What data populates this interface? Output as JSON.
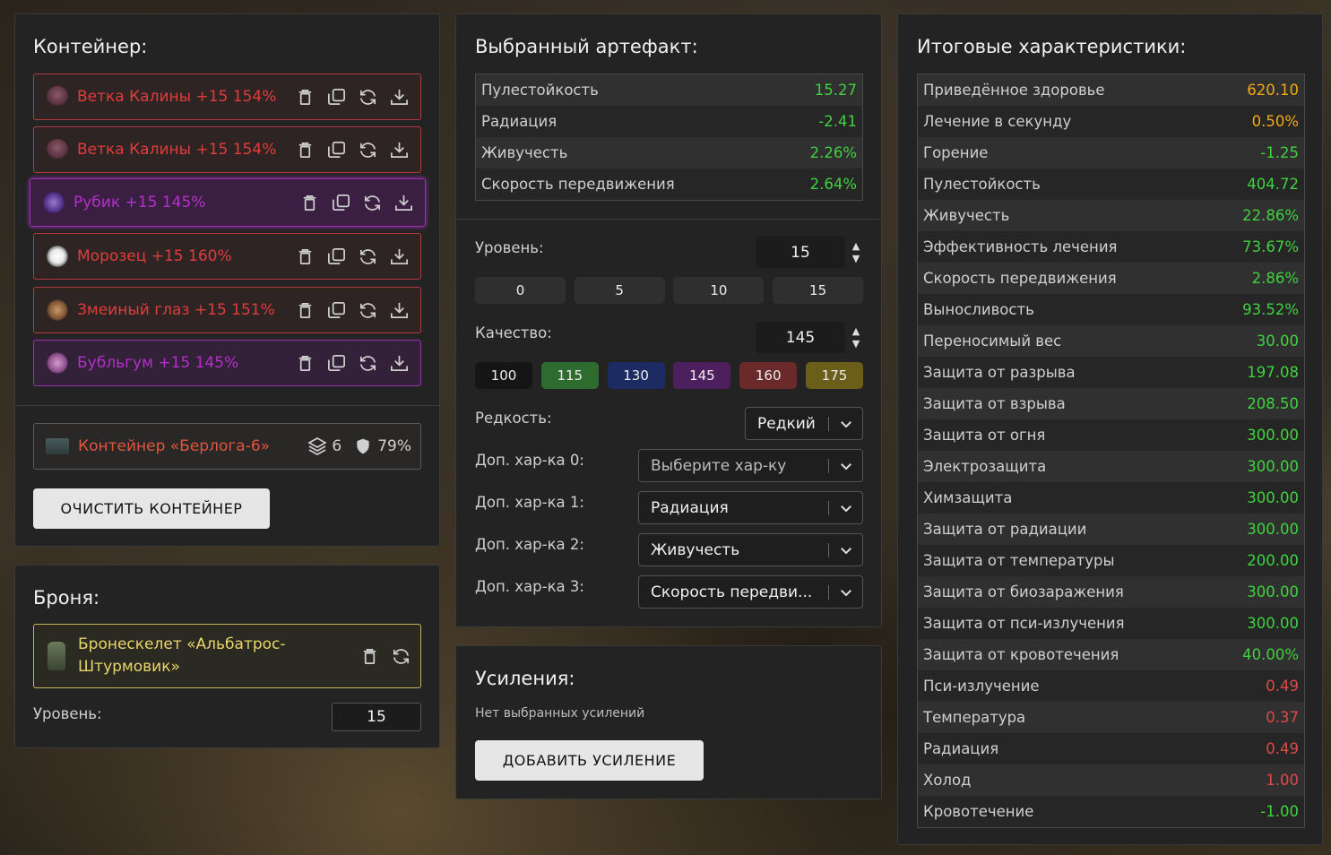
{
  "container": {
    "title": "Контейнер:",
    "artifacts": [
      {
        "name": "Ветка Калины",
        "suffix": " +15 154%",
        "color": "#e03c3c",
        "icon": "branch-icon"
      },
      {
        "name": "Ветка Калины",
        "suffix": " +15 154%",
        "color": "#e03c3c",
        "icon": "branch-icon"
      },
      {
        "name": "Рубик",
        "suffix": " +15 145%",
        "color": "#b530c9",
        "icon": "cube-icon"
      },
      {
        "name": "Морозец",
        "suffix": " +15 160%",
        "color": "#e03c3c",
        "icon": "frost-orb-icon"
      },
      {
        "name": "Змеиный глаз",
        "suffix": " +15 151%",
        "color": "#e03c3c",
        "icon": "snake-eye-icon"
      },
      {
        "name": "Бубльгум",
        "suffix": " +15 145%",
        "color": "#b530c9",
        "icon": "bubblegum-icon"
      }
    ],
    "item": {
      "name": "Контейнер «Берлога-6»",
      "slots": "6",
      "protection": "79%",
      "color": "#e0553c"
    },
    "clear_label": "ОЧИСТИТЬ КОНТЕЙНЕР"
  },
  "armor": {
    "title": "Броня:",
    "item_name": "Бронескелет «Альбатрос-Штурмовик»",
    "color": "#e9d56a",
    "level_label": "Уровень:",
    "level_value": "15"
  },
  "artifact": {
    "title": "Выбранный артефакт:",
    "stats": [
      {
        "label": "Пулестойкость",
        "value": "15.27",
        "tone": "green"
      },
      {
        "label": "Радиация",
        "value": "-2.41",
        "tone": "green"
      },
      {
        "label": "Живучесть",
        "value": "2.26%",
        "tone": "green"
      },
      {
        "label": "Скорость передвижения",
        "value": "2.64%",
        "tone": "green"
      }
    ],
    "level_label": "Уровень:",
    "level_value": "15",
    "level_presets": [
      "0",
      "5",
      "10",
      "15"
    ],
    "quality_label": "Качество:",
    "quality_value": "145",
    "quality_presets": [
      {
        "label": "100",
        "color": "#151515"
      },
      {
        "label": "115",
        "color": "#2e6b2e"
      },
      {
        "label": "130",
        "color": "#1c2c63"
      },
      {
        "label": "145",
        "color": "#4e1f5e"
      },
      {
        "label": "160",
        "color": "#6b2a2a"
      },
      {
        "label": "175",
        "color": "#6b5e1a"
      }
    ],
    "rarity_label": "Редкость:",
    "rarity_value": "Редкий",
    "extra": [
      {
        "label": "Доп. хар-ка 0:",
        "value": "Выберите хар-ку",
        "placeholder": true
      },
      {
        "label": "Доп. хар-ка 1:",
        "value": "Радиация",
        "placeholder": false
      },
      {
        "label": "Доп. хар-ка 2:",
        "value": "Живучесть",
        "placeholder": false
      },
      {
        "label": "Доп. хар-ка 3:",
        "value": "Скорость передви...",
        "placeholder": false
      }
    ]
  },
  "boosts": {
    "title": "Усиления:",
    "empty_text": "Нет выбранных усилений",
    "add_label": "ДОБАВИТЬ УСИЛЕНИЕ"
  },
  "totals": {
    "title": "Итоговые характеристики:",
    "stats": [
      {
        "label": "Приведённое здоровье",
        "value": "620.10",
        "tone": "orange"
      },
      {
        "label": "Лечение в секунду",
        "value": "0.50%",
        "tone": "orange"
      },
      {
        "label": "Горение",
        "value": "-1.25",
        "tone": "green"
      },
      {
        "label": "Пулестойкость",
        "value": "404.72",
        "tone": "green"
      },
      {
        "label": "Живучесть",
        "value": "22.86%",
        "tone": "green"
      },
      {
        "label": "Эффективность лечения",
        "value": "73.67%",
        "tone": "green"
      },
      {
        "label": "Скорость передвижения",
        "value": "2.86%",
        "tone": "green"
      },
      {
        "label": "Выносливость",
        "value": "93.52%",
        "tone": "green"
      },
      {
        "label": "Переносимый вес",
        "value": "30.00",
        "tone": "green"
      },
      {
        "label": "Защита от разрыва",
        "value": "197.08",
        "tone": "green"
      },
      {
        "label": "Защита от взрыва",
        "value": "208.50",
        "tone": "green"
      },
      {
        "label": "Защита от огня",
        "value": "300.00",
        "tone": "green"
      },
      {
        "label": "Электрозащита",
        "value": "300.00",
        "tone": "green"
      },
      {
        "label": "Химзащита",
        "value": "300.00",
        "tone": "green"
      },
      {
        "label": "Защита от радиации",
        "value": "300.00",
        "tone": "green"
      },
      {
        "label": "Защита от температуры",
        "value": "200.00",
        "tone": "green"
      },
      {
        "label": "Защита от биозаражения",
        "value": "300.00",
        "tone": "green"
      },
      {
        "label": "Защита от пси-излучения",
        "value": "300.00",
        "tone": "green"
      },
      {
        "label": "Защита от кровотечения",
        "value": "40.00%",
        "tone": "green"
      },
      {
        "label": "Пси-излучение",
        "value": "0.49",
        "tone": "red"
      },
      {
        "label": "Температура",
        "value": "0.37",
        "tone": "red"
      },
      {
        "label": "Радиация",
        "value": "0.49",
        "tone": "red"
      },
      {
        "label": "Холод",
        "value": "1.00",
        "tone": "red"
      },
      {
        "label": "Кровотечение",
        "value": "-1.00",
        "tone": "green"
      }
    ]
  }
}
